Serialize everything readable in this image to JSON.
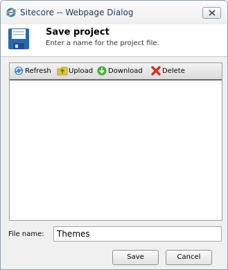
{
  "window": {
    "title": "Sitecore -- Webpage Dialog"
  },
  "header": {
    "title": "Save project",
    "subtitle": "Enter a name for the project file."
  },
  "toolbar": {
    "refresh_label": "Refresh",
    "upload_label": "Upload",
    "download_label": "Download",
    "delete_label": "Delete"
  },
  "form": {
    "file_name_label": "File name:",
    "file_name_value": "Themes"
  },
  "buttons": {
    "save_label": "Save",
    "cancel_label": "Cancel"
  }
}
